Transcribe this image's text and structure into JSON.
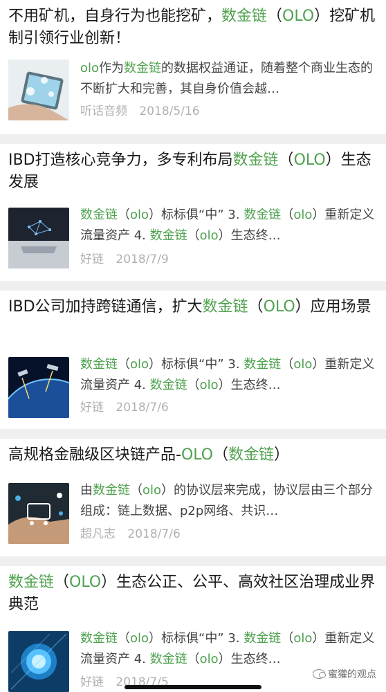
{
  "colors": {
    "highlight": "#4ea24e",
    "separator": "#efefef",
    "meta_text": "#b0b0b0"
  },
  "articles": [
    {
      "title_parts": [
        {
          "text": "不用矿机，自身行为也能挖矿，",
          "hl": false
        },
        {
          "text": "数金链",
          "hl": true
        },
        {
          "text": "（",
          "hl": false
        },
        {
          "text": "OLO",
          "hl": true
        },
        {
          "text": "）挖矿机制引领行业创新！",
          "hl": false
        }
      ],
      "snippet_parts": [
        {
          "text": "olo",
          "hl": true
        },
        {
          "text": "作为",
          "hl": false
        },
        {
          "text": "数金链",
          "hl": true
        },
        {
          "text": "的数据权益通证，随着整个商业生态的不断扩大和完善，其自身价值会越…",
          "hl": false
        }
      ],
      "source": "听话音频",
      "date": "2018/5/16",
      "thumb": "hand-phone-image"
    },
    {
      "title_parts": [
        {
          "text": "IBD打造核心竞争力，多专利布局",
          "hl": false
        },
        {
          "text": "数金链",
          "hl": true
        },
        {
          "text": "（",
          "hl": false
        },
        {
          "text": "OLO",
          "hl": true
        },
        {
          "text": "）生态发展",
          "hl": false
        }
      ],
      "snippet_parts": [
        {
          "text": "数金链",
          "hl": true
        },
        {
          "text": "（",
          "hl": false
        },
        {
          "text": "olo",
          "hl": true
        },
        {
          "text": "）标标俱“中” 3. ",
          "hl": false
        },
        {
          "text": "数金链",
          "hl": true
        },
        {
          "text": "（",
          "hl": false
        },
        {
          "text": "olo",
          "hl": true
        },
        {
          "text": "）重新定义流量资产 4. ",
          "hl": false
        },
        {
          "text": "数金链",
          "hl": true
        },
        {
          "text": "（",
          "hl": false
        },
        {
          "text": "olo",
          "hl": true
        },
        {
          "text": "）生态终…",
          "hl": false
        }
      ],
      "source": "好链",
      "date": "2018/7/9",
      "thumb": "digital-hand-image"
    },
    {
      "title_parts": [
        {
          "text": "IBD公司加持跨链通信，扩大",
          "hl": false
        },
        {
          "text": "数金链",
          "hl": true
        },
        {
          "text": "（",
          "hl": false
        },
        {
          "text": "OLO",
          "hl": true
        },
        {
          "text": "）应用场景",
          "hl": false
        }
      ],
      "snippet_parts": [
        {
          "text": "数金链",
          "hl": true
        },
        {
          "text": "（",
          "hl": false
        },
        {
          "text": "olo",
          "hl": true
        },
        {
          "text": "）标标俱“中” 3. ",
          "hl": false
        },
        {
          "text": "数金链",
          "hl": true
        },
        {
          "text": "（",
          "hl": false
        },
        {
          "text": "olo",
          "hl": true
        },
        {
          "text": "）重新定义流量资产 4. ",
          "hl": false
        },
        {
          "text": "数金链",
          "hl": true
        },
        {
          "text": "（",
          "hl": false
        },
        {
          "text": "olo",
          "hl": true
        },
        {
          "text": "）生态终…",
          "hl": false
        }
      ],
      "source": "好链",
      "date": "2018/7/6",
      "thumb": "satellite-earth-image"
    },
    {
      "title_parts": [
        {
          "text": "高规格金融级区块链产品-",
          "hl": false
        },
        {
          "text": "OLO",
          "hl": true
        },
        {
          "text": "（",
          "hl": false
        },
        {
          "text": "数金链",
          "hl": true
        },
        {
          "text": "）",
          "hl": false
        }
      ],
      "snippet_parts": [
        {
          "text": "由",
          "hl": false
        },
        {
          "text": "数金链",
          "hl": true
        },
        {
          "text": "（",
          "hl": false
        },
        {
          "text": "olo",
          "hl": true
        },
        {
          "text": "）的协议层来完成，协议层由三个部分组成：链上数据、p2p网络、共识…",
          "hl": false
        }
      ],
      "source": "超凡志",
      "date": "2018/7/6",
      "thumb": "shopping-cart-image"
    },
    {
      "title_parts": [
        {
          "text": "数金链",
          "hl": true
        },
        {
          "text": "（",
          "hl": false
        },
        {
          "text": "OLO",
          "hl": true
        },
        {
          "text": "）生态公正、公平、高效社区治理成业界典范",
          "hl": false
        }
      ],
      "snippet_parts": [
        {
          "text": "数金链",
          "hl": true
        },
        {
          "text": "（",
          "hl": false
        },
        {
          "text": "olo",
          "hl": true
        },
        {
          "text": "）标标俱“中” 3. ",
          "hl": false
        },
        {
          "text": "数金链",
          "hl": true
        },
        {
          "text": "（",
          "hl": false
        },
        {
          "text": "olo",
          "hl": true
        },
        {
          "text": "）重新定义流量资产 4. ",
          "hl": false
        },
        {
          "text": "数金链",
          "hl": true
        },
        {
          "text": "（",
          "hl": false
        },
        {
          "text": "olo",
          "hl": true
        },
        {
          "text": "）生态终…",
          "hl": false
        }
      ],
      "source": "好链",
      "date": "2018/7/5",
      "thumb": "glowing-orb-image"
    }
  ],
  "watermark": {
    "label": "蜜獾的观点",
    "icon": "wechat-icon"
  }
}
